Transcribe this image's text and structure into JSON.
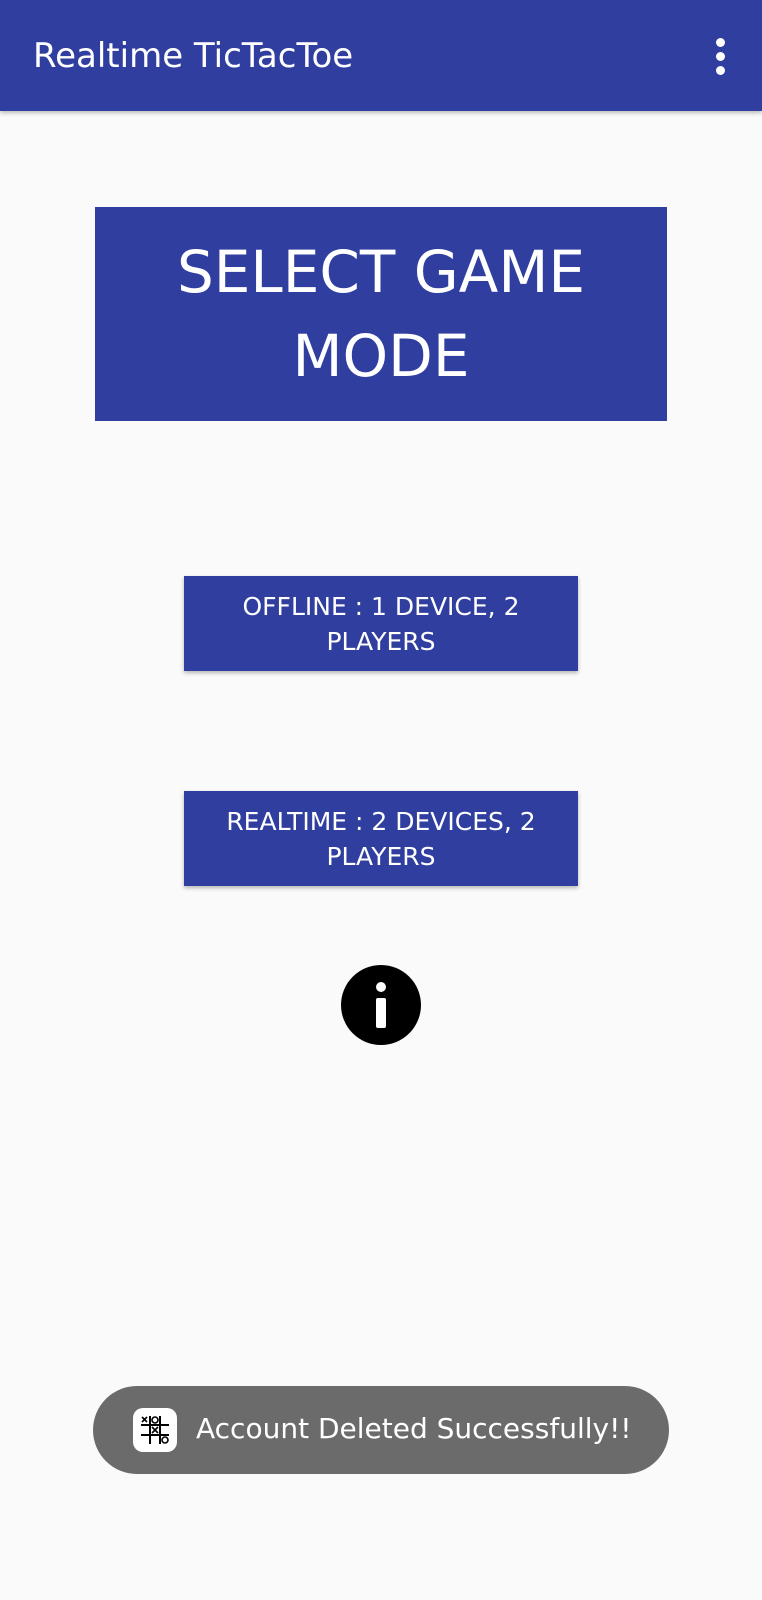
{
  "app_bar": {
    "title": "Realtime TicTacToe",
    "menu_icon": "more-vert-icon"
  },
  "main": {
    "heading": "SELECT GAME MODE",
    "offline_button": "OFFLINE : 1 DEVICE, 2 PLAYERS",
    "realtime_button": "REALTIME : 2 DEVICES, 2 PLAYERS",
    "info_icon": "info-icon"
  },
  "toast": {
    "icon": "tictactoe-app-icon",
    "message": "Account Deleted Successfully!!"
  },
  "colors": {
    "primary": "#303f9f",
    "background": "#fafafa",
    "toast_background": "#6b6b6b",
    "text_on_primary": "#ffffff"
  }
}
